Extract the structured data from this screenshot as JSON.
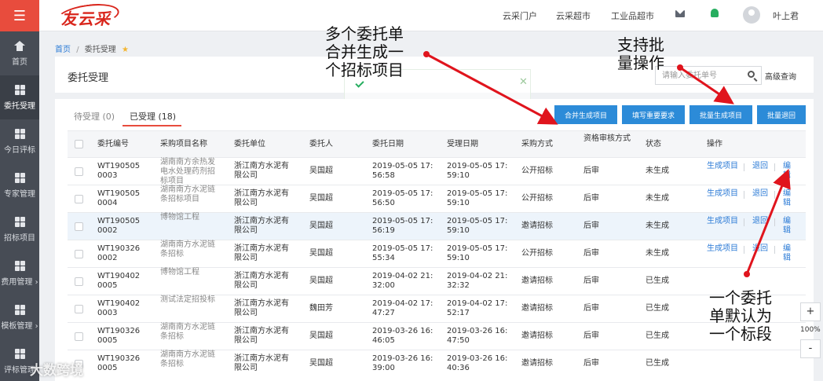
{
  "sidebar": {
    "items": [
      {
        "label": "首页",
        "icon": "home-icon"
      },
      {
        "label": "委托受理",
        "icon": "grid-icon",
        "active": true
      },
      {
        "label": "今日评标",
        "icon": "grid-icon"
      },
      {
        "label": "专家管理",
        "icon": "grid-icon"
      },
      {
        "label": "招标项目",
        "icon": "grid-icon"
      },
      {
        "label": "费用管理 ›",
        "icon": "grid-icon"
      },
      {
        "label": "模板管理 ›",
        "icon": "grid-icon"
      },
      {
        "label": "评标管理",
        "icon": "grid-icon"
      }
    ]
  },
  "topbar": {
    "logo": "友云采",
    "nav": [
      "云采门户",
      "云采超市",
      "工业品超市"
    ],
    "user_name": "叶上君"
  },
  "breadcrumb": {
    "home": "首页",
    "separator": "/",
    "current": "委托受理"
  },
  "header": {
    "title": "委托受理",
    "search_placeholder": "请输入委托单号",
    "advanced_search": "高级查询"
  },
  "tabs": [
    {
      "label": "待受理 (0)",
      "active": false
    },
    {
      "label": "已受理 (18)",
      "active": true
    }
  ],
  "actions": [
    "合并生成项目",
    "填写重要要求",
    "批量生成项目",
    "批量退回"
  ],
  "table": {
    "columns": [
      "委托编号",
      "采购项目名称",
      "委托单位",
      "委托人",
      "委托日期",
      "受理日期",
      "采购方式",
      "资格审核方式",
      "状态",
      "操作"
    ],
    "rows": [
      {
        "no": "WT1905050003",
        "name": "湖南南方余热发电水处理药剂招标项目",
        "unit": "浙江南方水泥有限公司",
        "person": "吴国超",
        "date": "2019-05-05 17:56:58",
        "accept": "2019-05-05 17:59:10",
        "method": "公开招标",
        "review": "后审",
        "status": "未生成",
        "ops": [
          "生成项目",
          "退回",
          "编辑"
        ]
      },
      {
        "no": "WT1905050004",
        "name": "湖南南方水泥链条招标项目",
        "unit": "浙江南方水泥有限公司",
        "person": "吴国超",
        "date": "2019-05-05 17:56:50",
        "accept": "2019-05-05 17:59:10",
        "method": "公开招标",
        "review": "后审",
        "status": "未生成",
        "ops": [
          "生成项目",
          "退回",
          "编辑"
        ]
      },
      {
        "no": "WT1905050002",
        "name": "博物馆工程",
        "unit": "浙江南方水泥有限公司",
        "person": "吴国超",
        "date": "2019-05-05 17:56:19",
        "accept": "2019-05-05 17:59:10",
        "method": "邀请招标",
        "review": "后审",
        "status": "未生成",
        "ops": [
          "生成项目",
          "退回",
          "编辑"
        ]
      },
      {
        "no": "WT1903260002",
        "name": "湖南南方水泥链条招标",
        "unit": "浙江南方水泥有限公司",
        "person": "吴国超",
        "date": "2019-05-05 17:55:34",
        "accept": "2019-05-05 17:59:10",
        "method": "公开招标",
        "review": "后审",
        "status": "未生成",
        "ops": [
          "生成项目",
          "退回",
          "编辑"
        ]
      },
      {
        "no": "WT1904020005",
        "name": "博物馆工程",
        "unit": "浙江南方水泥有限公司",
        "person": "吴国超",
        "date": "2019-04-02 21:32:00",
        "accept": "2019-04-02 21:32:32",
        "method": "邀请招标",
        "review": "后审",
        "status": "已生成",
        "ops": []
      },
      {
        "no": "WT1904020003",
        "name": "测试法定招投标",
        "unit": "浙江南方水泥有限公司",
        "person": "魏田芳",
        "date": "2019-04-02 17:47:27",
        "accept": "2019-04-02 17:52:17",
        "method": "邀请招标",
        "review": "后审",
        "status": "已生成",
        "ops": []
      },
      {
        "no": "WT1903260005",
        "name": "湖南南方水泥链条招标",
        "unit": "浙江南方水泥有限公司",
        "person": "吴国超",
        "date": "2019-03-26 16:46:05",
        "accept": "2019-03-26 16:47:50",
        "method": "邀请招标",
        "review": "后审",
        "status": "已生成",
        "ops": []
      },
      {
        "no": "WT1903260005",
        "name": "湖南南方水泥链条招标",
        "unit": "浙江南方水泥有限公司",
        "person": "吴国超",
        "date": "2019-03-26 16:39:00",
        "accept": "2019-03-26 16:40:36",
        "method": "邀请招标",
        "review": "后审",
        "status": "已生成",
        "ops": []
      }
    ]
  },
  "zoom": {
    "plus": "+",
    "level": "100%",
    "minus": "-"
  },
  "annotations": [
    {
      "id": "merge",
      "text": "多个委托单\n合并生成一\n个招标项目"
    },
    {
      "id": "batch",
      "text": "支持批\n量操作"
    },
    {
      "id": "single",
      "text": "一个委托\n单默认为\n一个标段"
    }
  ],
  "watermark": "大数跨境",
  "colors": {
    "accent": "#e84c3d",
    "primary": "#2c8bd8",
    "link": "#2c7bd6",
    "sidebar": "#474c55",
    "arrow": "#e0141d"
  }
}
